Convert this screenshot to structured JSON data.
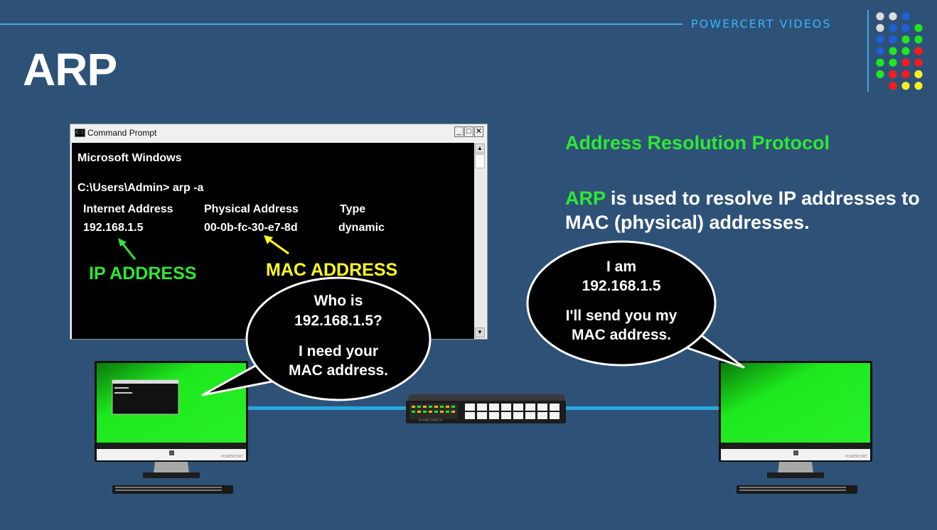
{
  "header": {
    "brand": "POWERCERT VIDEOS",
    "title": "ARP"
  },
  "cmd": {
    "window_title": "Command Prompt",
    "icon_text": "C:\\",
    "minimize": "_",
    "maximize": "□",
    "close": "✕",
    "line1": "Microsoft Windows",
    "line2": "C:\\Users\\Admin> arp -a",
    "columns": [
      "Internet Address",
      "Physical Address",
      "Type"
    ],
    "row": [
      "192.168.1.5",
      "00-0b-fc-30-e7-8d",
      "dynamic"
    ],
    "ip_label": "IP ADDRESS",
    "mac_label": "MAC ADDRESS"
  },
  "right": {
    "heading": "Address Resolution Protocol",
    "desc_highlight": "ARP",
    "desc_rest": " is used to resolve IP addresses to MAC (physical) addresses."
  },
  "bubble_left": {
    "line1": "Who is",
    "line2": "192.168.1.5?",
    "line3": "I need your",
    "line4": "MAC address."
  },
  "bubble_right": {
    "line1": "I am",
    "line2": "192.168.1.5",
    "line3": "I'll send you my",
    "line4": "MAC address."
  },
  "colors": {
    "background": "#2e5277",
    "accent_blue": "#39b3ff",
    "green": "#2ee834",
    "yellow": "#fffc1e",
    "screen_green": "#1ee81e"
  }
}
